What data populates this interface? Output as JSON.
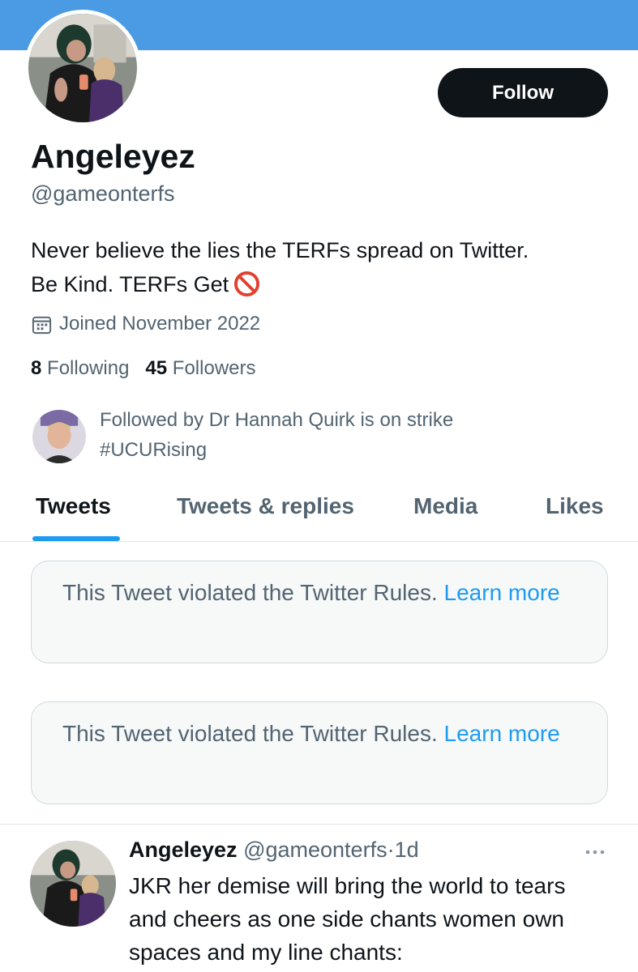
{
  "colors": {
    "banner": "#4a9be3",
    "accent": "#1d9bf0",
    "text_primary": "#0f1419",
    "text_secondary": "#536471",
    "button_bg": "#0f1419"
  },
  "profile": {
    "display_name": "Angeleyez",
    "handle": "@gameonterfs",
    "follow_label": "Follow",
    "bio_line1": "Never believe the lies the TERFs spread on Twitter.",
    "bio_line2": "Be Kind. TERFs Get",
    "bio_emoji_icon": "no-entry-icon",
    "joined": "Joined November 2022",
    "following_count": "8",
    "following_label": "Following",
    "followers_count": "45",
    "followers_label": "Followers",
    "followed_by": "Followed by Dr Hannah Quirk is on strike #UCURising"
  },
  "tabs": [
    {
      "label": "Tweets",
      "active": true
    },
    {
      "label": "Tweets & replies",
      "active": false
    },
    {
      "label": "Media",
      "active": false
    },
    {
      "label": "Likes",
      "active": false
    }
  ],
  "notices": [
    {
      "text": "This Tweet violated the Twitter Rules.",
      "link": "Learn more"
    },
    {
      "text": "This Tweet violated the Twitter Rules.",
      "link": "Learn more"
    }
  ],
  "tweet": {
    "name": "Angeleyez",
    "handle": "@gameonterfs",
    "separator": "·",
    "time": "1d",
    "more_icon": "more-dots-icon",
    "text_line1": "JKR her demise will bring the world to tears",
    "text_line2": "and cheers as one side chants women own",
    "text_line3": "spaces and my line chants:"
  }
}
